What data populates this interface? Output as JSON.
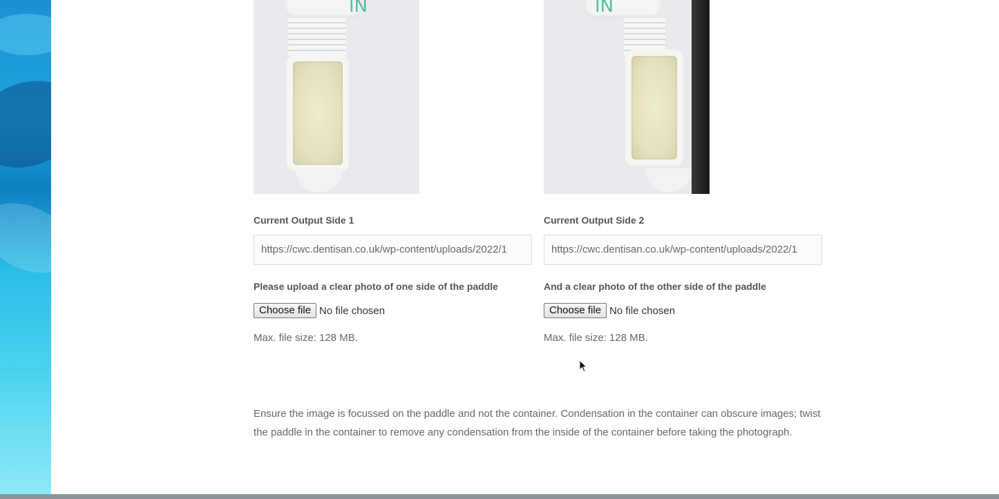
{
  "side1": {
    "photo_alt": "Paddle photo side 1",
    "cap_text": "IN",
    "output_label": "Current Output Side 1",
    "output_value": "https://cwc.dentisan.co.uk/wp-content/uploads/2022/1",
    "upload_label": "Please upload a clear photo of one side of the paddle",
    "choose_file": "Choose file",
    "file_status": "No file chosen",
    "max_size": "Max. file size: 128 MB."
  },
  "side2": {
    "photo_alt": "Paddle photo side 2",
    "cap_text": "IN",
    "output_label": "Current Output Side 2",
    "output_value": "https://cwc.dentisan.co.uk/wp-content/uploads/2022/1",
    "upload_label": "And a clear photo of the other side of the paddle",
    "choose_file": "Choose file",
    "file_status": "No file chosen",
    "max_size": "Max. file size: 128 MB."
  },
  "note": "Ensure the image is focussed on the paddle and not the container. Condensation in the container can obscure images; twist the paddle in the container to remove any condensation from the inside of the container before taking the photograph.",
  "colors": {
    "banner": "#1aa6de",
    "label": "#555555",
    "text": "#666666"
  }
}
